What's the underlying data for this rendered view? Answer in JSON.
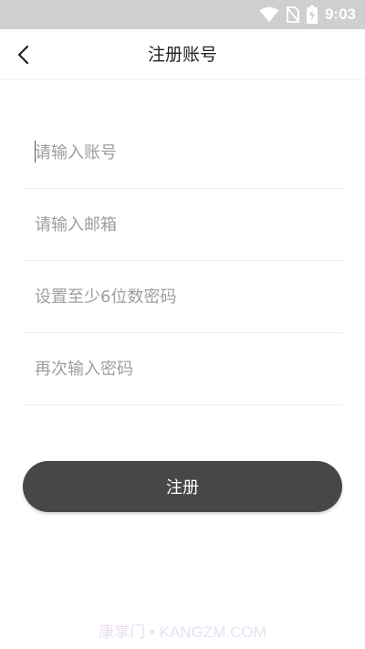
{
  "status_bar": {
    "time": "9:03",
    "icons": [
      "wifi-icon",
      "no-sim-icon",
      "battery-charging-icon"
    ]
  },
  "header": {
    "title": "注册账号",
    "back_icon": "chevron-left-icon"
  },
  "form": {
    "account_placeholder": "请输入账号",
    "email_placeholder": "请输入邮箱",
    "password_placeholder": "设置至少6位数密码",
    "confirm_password_placeholder": "再次输入密码",
    "account_value": "",
    "email_value": "",
    "password_value": "",
    "confirm_password_value": ""
  },
  "submit": {
    "label": "注册"
  },
  "watermark": "康掌门 • KANGZM.COM",
  "colors": {
    "status_bar": "#cfcfcf",
    "button": "#474747",
    "placeholder": "#9e9e9e",
    "divider": "#ededed"
  }
}
